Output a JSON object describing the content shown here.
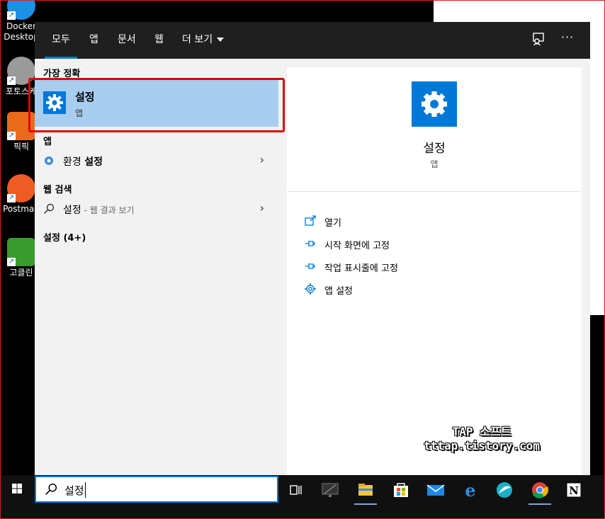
{
  "desktop": {
    "icons": [
      {
        "label": "Docker\nDesktop",
        "icon": "docker-icon",
        "color": "#1d91e6"
      },
      {
        "label": "포토스케",
        "icon": "photoscape-icon",
        "color": "#c0c0c0"
      },
      {
        "label": "픽픽",
        "icon": "picpick-icon",
        "color": "#e86b1c"
      },
      {
        "label": "Postman",
        "icon": "postman-icon",
        "color": "#ef5b25"
      },
      {
        "label": "고클린",
        "icon": "goclean-icon",
        "color": "#3a9a30"
      }
    ]
  },
  "tabs": [
    {
      "label": "모두",
      "active": true
    },
    {
      "label": "앱"
    },
    {
      "label": "문서"
    },
    {
      "label": "웹"
    },
    {
      "label": "더 보기"
    }
  ],
  "topbar_icons": [
    "feedback-icon",
    "more-icon"
  ],
  "more_glyph": "···",
  "left": {
    "best_section": "가장 정확",
    "best": {
      "name": "설정",
      "type": "앱",
      "icon": "gear-icon"
    },
    "app_section": "앱",
    "app_item": {
      "label_pre": "환경 ",
      "label_bold": "설정",
      "icon": "control-panel-icon"
    },
    "web_section": "웹 검색",
    "web_item": {
      "label": "설정",
      "suffix": " - 웹 결과 보기",
      "icon": "search-icon"
    },
    "settings_section": "설정 (4+)"
  },
  "right": {
    "name": "설정",
    "type": "앱",
    "actions": [
      {
        "label": "열기",
        "icon": "open-icon"
      },
      {
        "label": "시작 화면에 고정",
        "icon": "pin-icon"
      },
      {
        "label": "작업 표시줄에 고정",
        "icon": "pin-icon"
      },
      {
        "label": "앱 설정",
        "icon": "gear-icon"
      }
    ]
  },
  "watermark": {
    "line1": "TAP 소프트",
    "line2": "tttap.tistory.com"
  },
  "taskbar": {
    "search_value": "설정",
    "apps": [
      "task-view-icon",
      "monitor-icon",
      "file-explorer-icon",
      "store-icon",
      "mail-icon",
      "edge-icon",
      "app-icon",
      "chrome-icon",
      "notion-icon"
    ]
  },
  "colors": {
    "accent": "#0078d7",
    "selected": "#a9cdee",
    "highlight_border": "#e00000"
  }
}
